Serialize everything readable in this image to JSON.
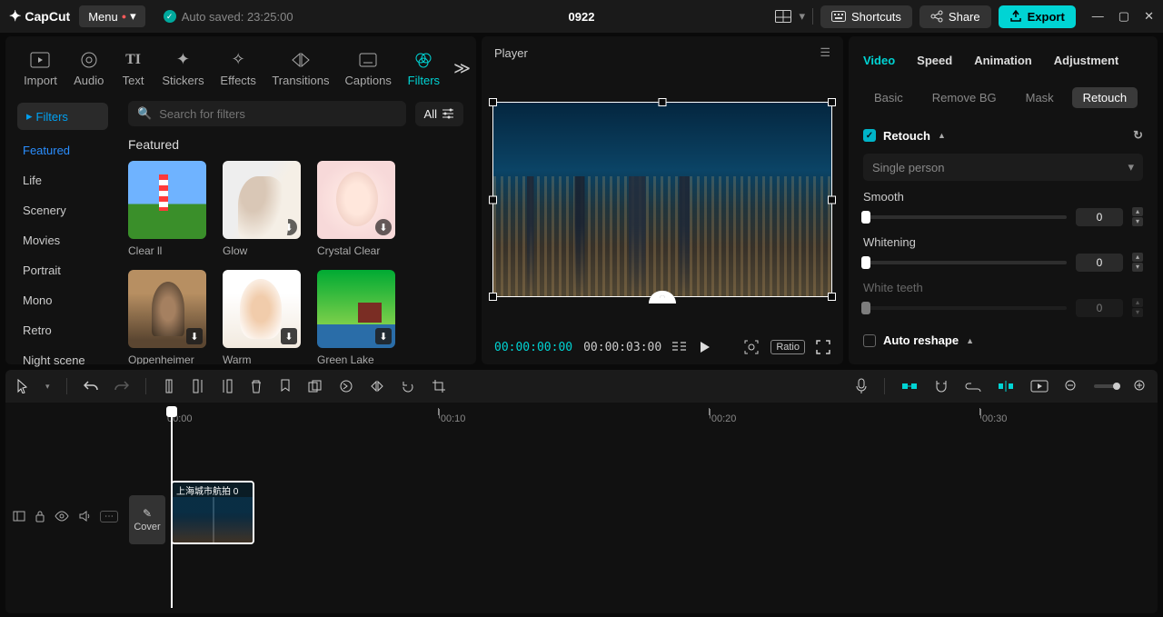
{
  "app": {
    "name": "CapCut",
    "menu_label": "Menu",
    "autosave": "Auto saved: 23:25:00",
    "project": "0922"
  },
  "topbar": {
    "shortcuts": "Shortcuts",
    "share": "Share",
    "export": "Export"
  },
  "media_tabs": {
    "import": "Import",
    "audio": "Audio",
    "text": "Text",
    "stickers": "Stickers",
    "effects": "Effects",
    "transitions": "Transitions",
    "captions": "Captions",
    "filters": "Filters"
  },
  "filter_sidebar": {
    "filters_label": "Filters",
    "categories": [
      "Featured",
      "Life",
      "Scenery",
      "Movies",
      "Portrait",
      "Mono",
      "Retro",
      "Night scene"
    ]
  },
  "filter_content": {
    "search_placeholder": "Search for filters",
    "all_label": "All",
    "section": "Featured",
    "items": [
      "Clear ll",
      "Glow",
      "Crystal Clear",
      "Oppenheimer",
      "Warm",
      "Green Lake"
    ]
  },
  "player": {
    "title": "Player",
    "current": "00:00:00:00",
    "total": "00:00:03:00",
    "ratio": "Ratio"
  },
  "inspector": {
    "tabs": {
      "video": "Video",
      "speed": "Speed",
      "animation": "Animation",
      "adjustment": "Adjustment"
    },
    "subtabs": {
      "basic": "Basic",
      "removebg": "Remove BG",
      "mask": "Mask",
      "retouch": "Retouch"
    },
    "retouch_label": "Retouch",
    "mode": "Single person",
    "smooth_label": "Smooth",
    "smooth_value": "0",
    "whitening_label": "Whitening",
    "whitening_value": "0",
    "teeth_label": "White teeth",
    "teeth_value": "0",
    "auto_reshape": "Auto reshape"
  },
  "timeline": {
    "ticks": [
      "00:00",
      "00:10",
      "00:20",
      "00:30"
    ],
    "cover": "Cover",
    "clip_title": "上海城市航拍   0"
  }
}
